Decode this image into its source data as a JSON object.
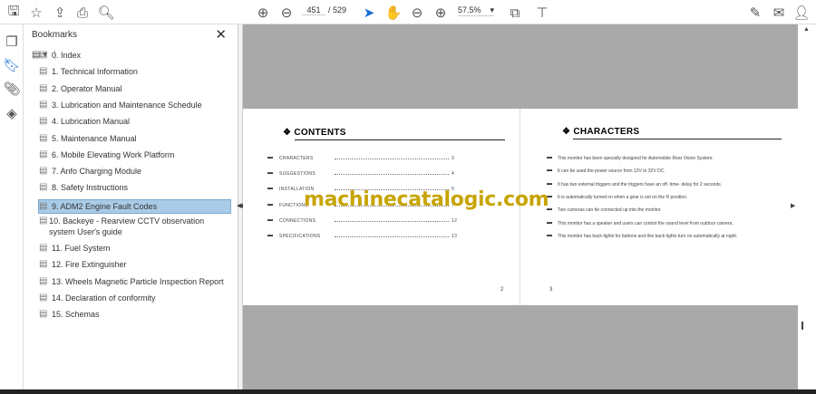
{
  "toolbar": {
    "page_current": "451",
    "page_total": "/ 529",
    "zoom": "57.5%",
    "icons": [
      "save-icon",
      "bookmark-star-icon",
      "upload-icon",
      "print-icon",
      "find-icon",
      "page-up-icon",
      "page-down-icon",
      "select-cursor-icon",
      "hand-icon",
      "zoom-out-icon",
      "zoom-in-icon",
      "fit-page-icon",
      "read-mode-icon",
      "sign-icon",
      "mail-icon",
      "account-icon"
    ]
  },
  "panel": {
    "title": "Bookmarks",
    "close": "✕",
    "options": "▤ ▾",
    "bookmarks": [
      {
        "label": "0. Index"
      },
      {
        "label": "1. Technical Information"
      },
      {
        "label": "2. Operator Manual"
      },
      {
        "label": "3. Lubrication and Maintenance Schedule"
      },
      {
        "label": "4. Lubrication Manual"
      },
      {
        "label": "5. Maintenance Manual"
      },
      {
        "label": "6. Mobile Elevating Work Platform"
      },
      {
        "label": "7. Anfo Charging Module"
      },
      {
        "label": "8. Safety Instructions"
      },
      {
        "label": "9. ADM2 Engine Fault Codes",
        "selected": true
      },
      {
        "label": "10. Backeye - Rearview CCTV observation system User's guide"
      },
      {
        "label": "11. Fuel System"
      },
      {
        "label": "12. Fire Extinguisher"
      },
      {
        "label": "13. Wheels Magnetic Particle Inspection Report"
      },
      {
        "label": "14. Declaration of conformity"
      },
      {
        "label": "15. Schemas"
      }
    ]
  },
  "left_page": {
    "heading": "CONTENTS",
    "items": [
      {
        "t": "CHARACTERS",
        "p": "3"
      },
      {
        "t": "SUGGESTIONS",
        "p": "4"
      },
      {
        "t": "INSTALLATION",
        "p": "5"
      },
      {
        "t": "FUNCTIONS",
        "p": "7"
      },
      {
        "t": "CONNECTIONS",
        "p": "12"
      },
      {
        "t": "SPECIFICATIONS",
        "p": "13"
      }
    ],
    "page_no": "2"
  },
  "right_page": {
    "heading": "CHARACTERS",
    "items": [
      "This monitor has been specially designed for Automobile Rear Vision System.",
      "It can be used the power source from 12V to 32V DC.",
      "It has two external triggers and the triggers have an off- time- delay for 2 seconds.",
      "It is automatically turned on when a gear is set on the  R  position.",
      "Two cameras can be connected up into the monitor.",
      "This monitor has a speaker and users can control the sound level from outdoor camera.",
      "This monitor  has  back-lights for buttons and this back-lights turn on automatically at night."
    ],
    "page_no": "3"
  },
  "watermark": "machinecatalogic.com"
}
